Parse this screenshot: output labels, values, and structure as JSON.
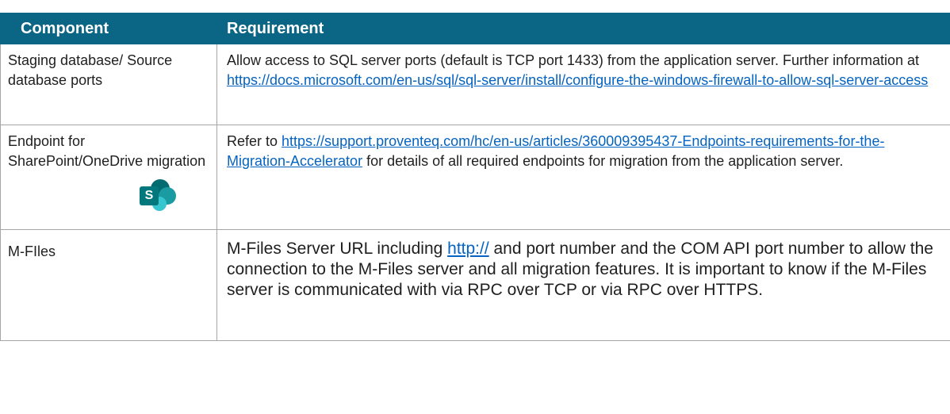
{
  "table": {
    "headers": [
      "Component",
      "Requirement"
    ],
    "rows": [
      {
        "component": "Staging database/ Source database ports",
        "req_text_1": "Allow access to SQL server ports (default is TCP port 1433) from the application server. Further information at ",
        "req_link": "https://docs.microsoft.com/en-us/sql/sql-server/install/configure-the-windows-firewall-to-allow-sql-server-access",
        "req_text_2": ""
      },
      {
        "component": "Endpoint for SharePoint/OneDrive migration",
        "req_text_1": "Refer to ",
        "req_link": "https://support.proventeq.com/hc/en-us/articles/360009395437-Endpoints-requirements-for-the-Migration-Accelerator",
        "req_text_2": " for details of all required endpoints for migration from the application server.",
        "icon": "sharepoint-icon",
        "icon_letter": "S"
      },
      {
        "component": "M-FIles",
        "req_text_1": "M-Files Server URL including ",
        "req_link": "http://",
        "req_text_2": " and port number and the COM API port number to allow the connection to the M-Files server and all migration features. It is important to know if the M-Files server is communicated with via RPC over TCP or via RPC over HTTPS."
      }
    ]
  },
  "colors": {
    "header_bg": "#0b6584",
    "link": "#0563c1",
    "border": "#a6a6a6"
  }
}
